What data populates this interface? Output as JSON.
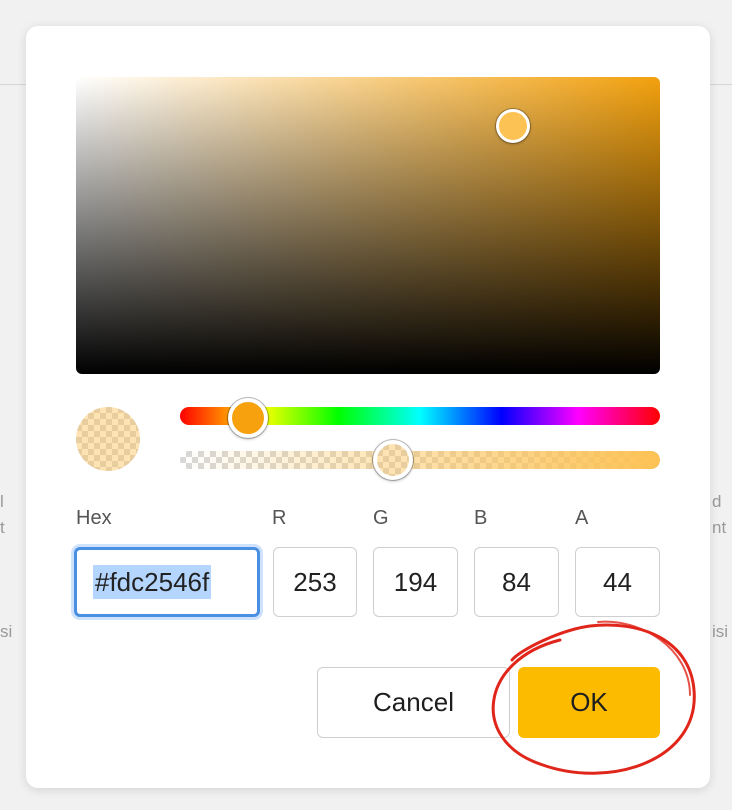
{
  "background": {
    "fragments": [
      "l",
      "t",
      "si",
      "d",
      "nt",
      "isi"
    ]
  },
  "color": {
    "hex": "#fdc2546f",
    "r": "253",
    "g": "194",
    "b": "84",
    "a": "44",
    "accent": "#fdc254",
    "ok_color": "#fdbb00"
  },
  "labels": {
    "hex": "Hex",
    "r": "R",
    "g": "G",
    "b": "B",
    "a": "A"
  },
  "buttons": {
    "cancel": "Cancel",
    "ok": "OK"
  }
}
